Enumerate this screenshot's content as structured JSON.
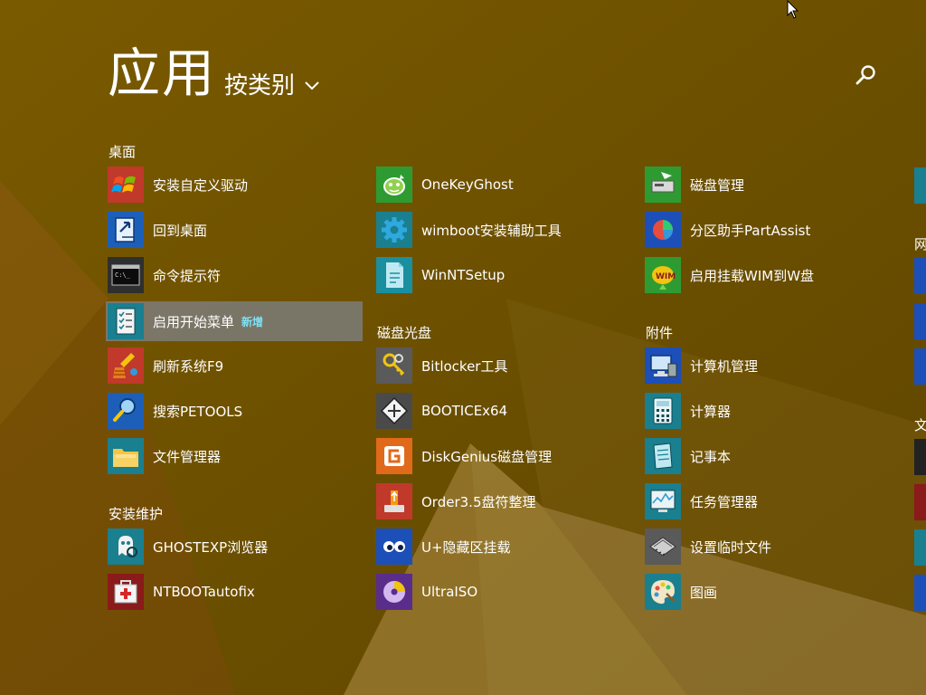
{
  "header": {
    "title": "应用",
    "sort_label": "按类别",
    "sort_icon": "chevron-down-icon",
    "search_icon": "search-icon"
  },
  "colors": {
    "background": "#6e5200",
    "selected_item": "#7d8084",
    "new_badge": "#7fe0f5"
  },
  "groups": {
    "desktop": {
      "name": "桌面",
      "items": [
        {
          "label": "安装自定义驱动",
          "icon": "windows-flag-icon"
        },
        {
          "label": "回到桌面",
          "icon": "desktop-return-icon"
        },
        {
          "label": "命令提示符",
          "icon": "command-prompt-icon"
        },
        {
          "label": "启用开始菜单",
          "icon": "start-menu-icon",
          "badge": "新增"
        },
        {
          "label": "刷新系统F9",
          "icon": "refresh-broom-icon"
        },
        {
          "label": "搜索PETOOLS",
          "icon": "magnifier-icon"
        },
        {
          "label": "文件管理器",
          "icon": "folder-icon"
        }
      ]
    },
    "maintenance": {
      "name": "安装维护",
      "items": [
        {
          "label": "GHOSTEXP浏览器",
          "icon": "ghost-explorer-icon"
        },
        {
          "label": "NTBOOTautofix",
          "icon": "first-aid-kit-icon"
        }
      ]
    },
    "ghost_tools": {
      "items": [
        {
          "label": "OneKeyGhost",
          "icon": "ghost-green-icon"
        },
        {
          "label": "wimboot安装辅助工具",
          "icon": "gear-icon"
        },
        {
          "label": "WinNTSetup",
          "icon": "setup-file-icon"
        }
      ]
    },
    "disk": {
      "name": "磁盘光盘",
      "items": [
        {
          "label": "Bitlocker工具",
          "icon": "keys-icon"
        },
        {
          "label": "BOOTICEx64",
          "icon": "bootice-icon"
        },
        {
          "label": "DiskGenius磁盘管理",
          "icon": "diskgenius-icon"
        },
        {
          "label": "Order3.5盘符整理",
          "icon": "usb-drive-icon"
        },
        {
          "label": "U+隐藏区挂载",
          "icon": "eyes-icon"
        },
        {
          "label": "UltraISO",
          "icon": "disc-icon"
        }
      ]
    },
    "disk_tools": {
      "items": [
        {
          "label": "磁盘管理",
          "icon": "disk-management-icon"
        },
        {
          "label": "分区助手PartAssist",
          "icon": "partition-icon"
        },
        {
          "label": "启用挂载WIM到W盘",
          "icon": "wim-mount-icon"
        }
      ]
    },
    "accessories": {
      "name": "附件",
      "items": [
        {
          "label": "计算机管理",
          "icon": "computer-management-icon"
        },
        {
          "label": "计算器",
          "icon": "calculator-icon"
        },
        {
          "label": "记事本",
          "icon": "notepad-icon"
        },
        {
          "label": "任务管理器",
          "icon": "task-manager-icon"
        },
        {
          "label": "设置临时文件",
          "icon": "memory-chip-icon"
        },
        {
          "label": "图画",
          "icon": "paint-palette-icon"
        }
      ]
    },
    "partial_categories": [
      {
        "name": "网"
      },
      {
        "name": "文"
      }
    ]
  }
}
